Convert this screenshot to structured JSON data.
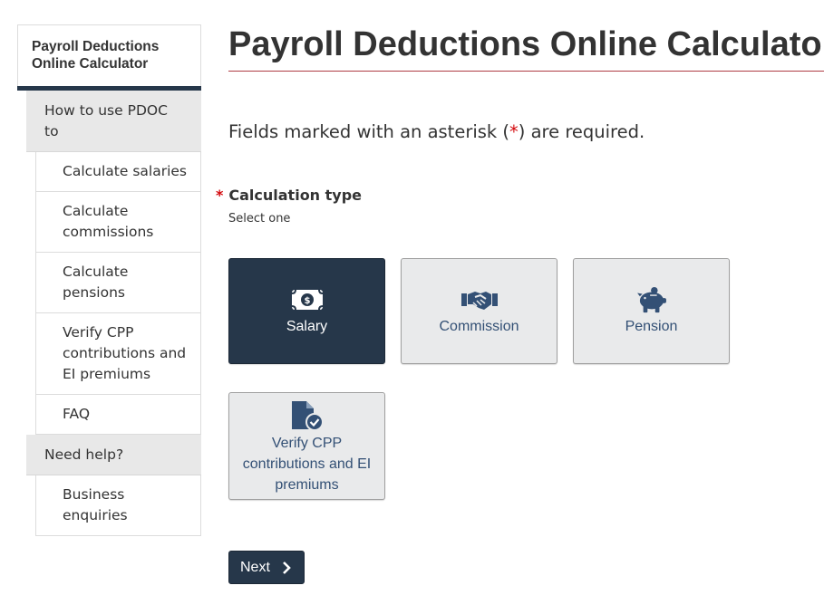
{
  "sidebar": {
    "title": "Payroll Deductions Online Calculator",
    "groups": [
      {
        "label": "How to use PDOC to",
        "items": [
          {
            "label": "Calculate salaries"
          },
          {
            "label": "Calculate commissions"
          },
          {
            "label": "Calculate pensions"
          },
          {
            "label": "Verify CPP contributions and EI premiums"
          },
          {
            "label": "FAQ"
          }
        ]
      },
      {
        "label": "Need help?",
        "items": [
          {
            "label": "Business enquiries"
          }
        ]
      }
    ]
  },
  "main": {
    "title": "Payroll Deductions Online Calculator",
    "required_note_before": "Fields marked with an asterisk (",
    "required_star": "*",
    "required_note_after": ") are required.",
    "calc_type": {
      "star": "*",
      "label": "Calculation type",
      "hint": "Select one",
      "options": [
        {
          "label": "Salary",
          "icon": "money-icon",
          "selected": true
        },
        {
          "label": "Commission",
          "icon": "handshake-icon",
          "selected": false
        },
        {
          "label": "Pension",
          "icon": "piggy-bank-icon",
          "selected": false
        },
        {
          "label": "Verify CPP contributions and EI premiums",
          "icon": "document-check-icon",
          "selected": false
        }
      ]
    },
    "next_button": "Next"
  },
  "colors": {
    "primary": "#26374a",
    "link": "#335075",
    "required": "#d3080c",
    "title_rule": "#af3c43",
    "tile_bg": "#e9eaeb"
  }
}
